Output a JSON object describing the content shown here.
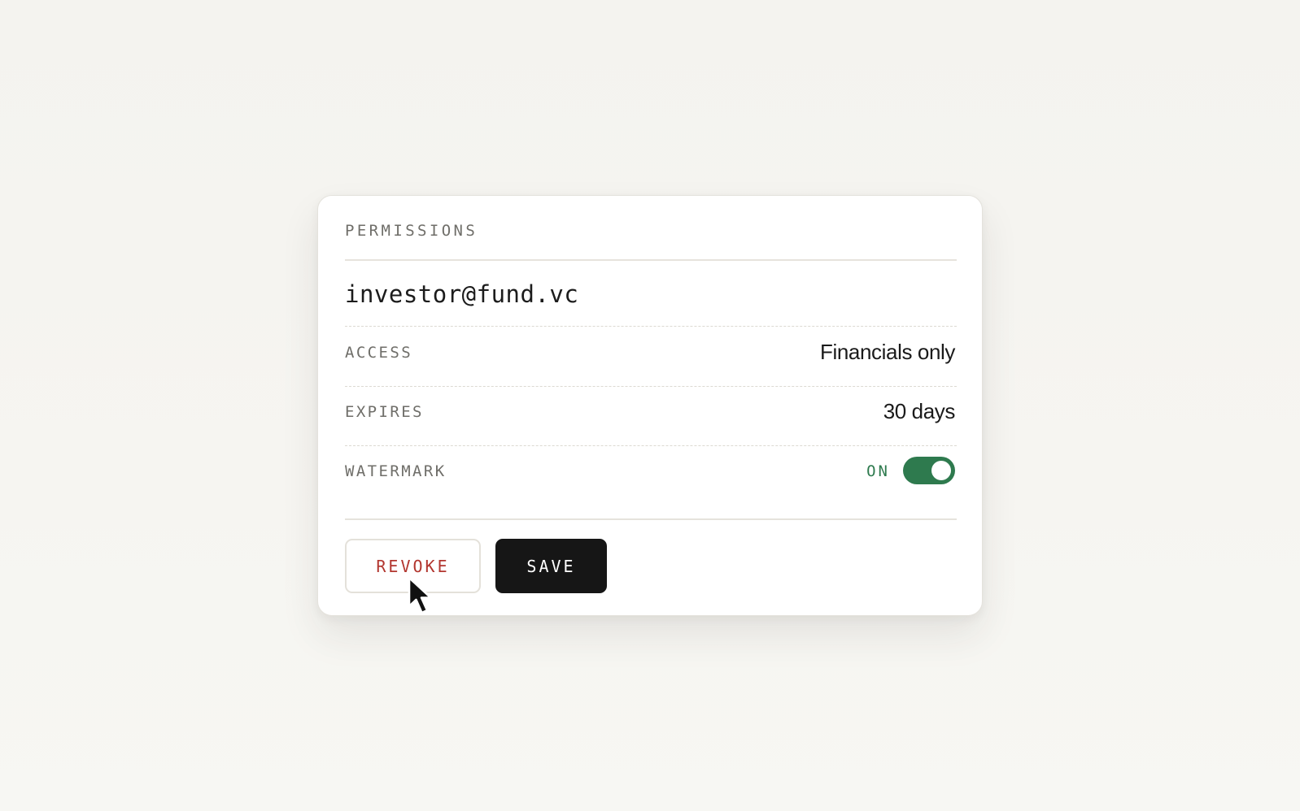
{
  "panel": {
    "title": "PERMISSIONS",
    "recipient_email": "investor@fund.vc"
  },
  "rows": {
    "access": {
      "label": "ACCESS",
      "value": "Financials only"
    },
    "expires": {
      "label": "EXPIRES",
      "value": "30 days"
    },
    "watermark": {
      "label": "WATERMARK",
      "state_text": "ON",
      "enabled": true
    }
  },
  "actions": {
    "revoke_label": "REVOKE",
    "save_label": "SAVE"
  },
  "colors": {
    "accent_green": "#2e7a4e",
    "danger_red": "#b2362f",
    "primary_dark": "#161616"
  },
  "icons": {
    "cursor": "mouse-pointer-icon"
  }
}
